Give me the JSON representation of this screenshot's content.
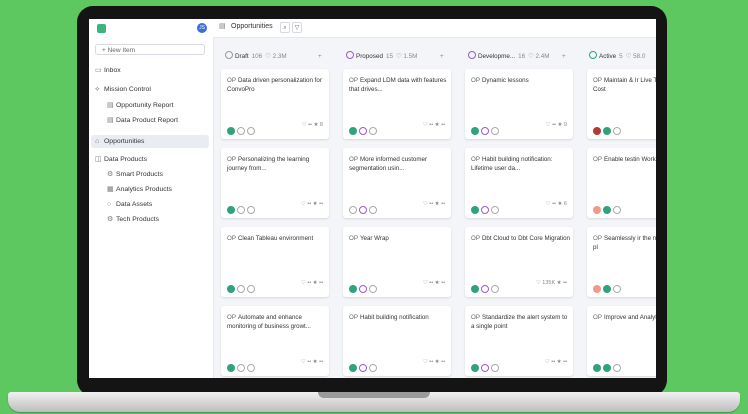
{
  "app": {
    "title": "Opportunities",
    "user_initials": "JS"
  },
  "sidebar": {
    "new_item": "+ New Item",
    "items": [
      {
        "label": "Inbox",
        "icon": "inbox-icon"
      },
      {
        "label": "Mission Control",
        "icon": "rocket-icon"
      },
      {
        "label": "Opportunity Report",
        "icon": "report-icon"
      },
      {
        "label": "Data Product Report",
        "icon": "report-icon"
      },
      {
        "label": "Opportunities",
        "icon": "opportunity-icon"
      },
      {
        "label": "Data Products",
        "icon": "products-icon"
      },
      {
        "label": "Smart Products",
        "icon": "smart-icon"
      },
      {
        "label": "Analytics Products",
        "icon": "analytics-icon"
      },
      {
        "label": "Data Assets",
        "icon": "assets-icon"
      },
      {
        "label": "Tech Products",
        "icon": "tech-icon"
      }
    ]
  },
  "columns": [
    {
      "name": "Draft",
      "count": "106",
      "metric": "♡ 2.3M",
      "cards": [
        {
          "title": "Data driven personalization for ConvoPro",
          "stat": "♡ ••  ★ 8"
        },
        {
          "title": "Personalizing the learning journey from...",
          "stat": "♡ ••  ★ ••"
        },
        {
          "title": "Clean Tableau environment",
          "stat": "♡ ••  ★ ••"
        },
        {
          "title": "Automate and enhance monitoring of business growt...",
          "stat": "♡ ••  ★ ••"
        }
      ]
    },
    {
      "name": "Proposed",
      "count": "15",
      "metric": "♡ 1.5M",
      "cards": [
        {
          "title": "Expand LDM data with features that drives...",
          "stat": "♡ ••  ★ ••"
        },
        {
          "title": "More informed customer segmentation usin...",
          "stat": "♡ ••  ★ ••"
        },
        {
          "title": "Year Wrap",
          "stat": "♡ ••  ★ ••"
        },
        {
          "title": "Habit building notification",
          "stat": "♡ ••  ★ ••"
        }
      ]
    },
    {
      "name": "Developme...",
      "count": "16",
      "metric": "♡ 2.4M",
      "cards": [
        {
          "title": "Dynamic lessons",
          "stat": "♡ ••  ★ 9"
        },
        {
          "title": "Habit building notification: Lifetime user da...",
          "stat": "♡ ••  ★ 6"
        },
        {
          "title": "Dbt Cloud to Dbt Core Migration",
          "stat": "♡ 135K  ★ ••"
        },
        {
          "title": "Standardize the alert system to a single point",
          "stat": "♡ ••  ★ ••"
        }
      ]
    },
    {
      "name": "Active",
      "count": "5",
      "metric": "♡ 58.0",
      "cards": [
        {
          "title": "Maintain & Ir Live Teacher's Cost",
          "stat": "♡ 5"
        },
        {
          "title": "Enable testin Workday integratio",
          "stat": "♡ ••"
        },
        {
          "title": "Seamlessly ir the new payment pl",
          "stat": "♡ ••"
        },
        {
          "title": "Improve and Analytics Layer",
          "stat": "♡ ••"
        }
      ]
    }
  ],
  "card_prefix": "OP",
  "colors": {
    "accent": "#2fa37b",
    "proposed": "#9b59d0",
    "background": "#5cc85f"
  }
}
